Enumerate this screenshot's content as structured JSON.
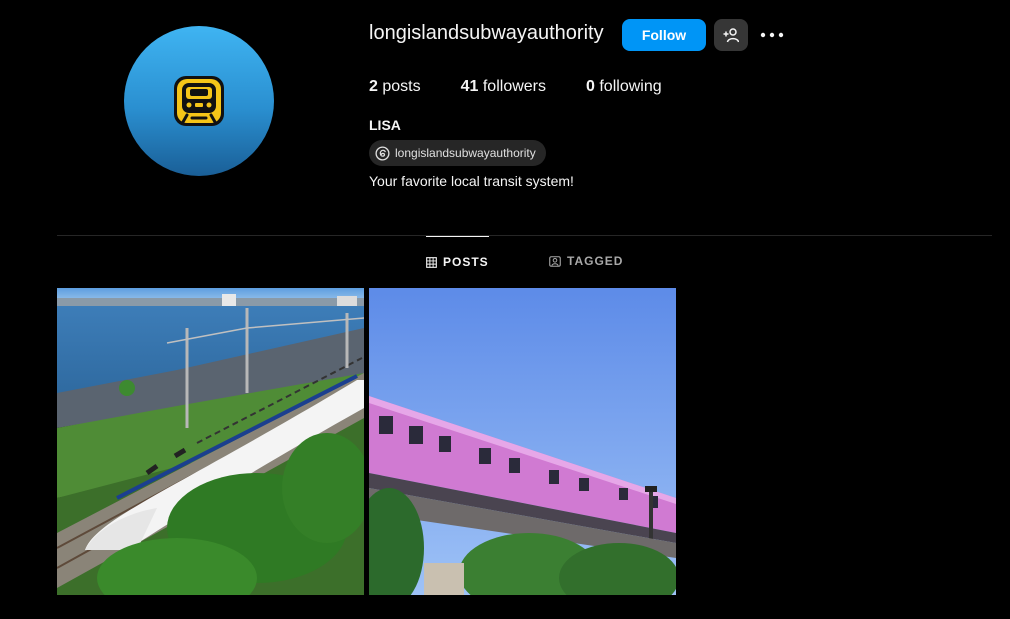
{
  "profile": {
    "username": "longislandsubwayauthority",
    "follow_label": "Follow",
    "full_name": "LISA",
    "threads_handle": "longislandsubwayauthority",
    "bio": "Your favorite local transit system!"
  },
  "stats": {
    "posts_count": "2",
    "posts_label": "posts",
    "followers_count": "41",
    "followers_label": "followers",
    "following_count": "0",
    "following_label": "following"
  },
  "tabs": {
    "posts_label": "POSTS",
    "tagged_label": "TAGGED"
  },
  "icons": {
    "avatar": "subway-train-logo-icon",
    "suggest": "add-person-icon",
    "more": "more-options-icon",
    "threads": "threads-icon",
    "posts_tab": "grid-icon",
    "tagged_tab": "tagged-person-icon"
  },
  "colors": {
    "accent": "#0095f6",
    "background": "#000000"
  }
}
